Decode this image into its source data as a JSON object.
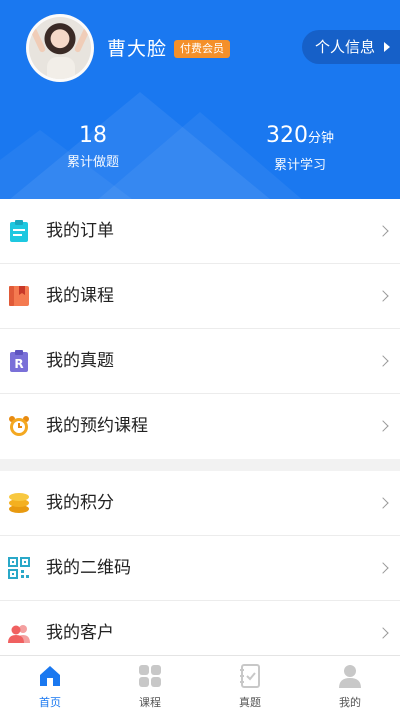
{
  "profile": {
    "name": "曹大脸",
    "badge": "付费会员",
    "info_button": "个人信息"
  },
  "stats": {
    "questions_count": "18",
    "questions_label": "累计做题",
    "study_value": "320",
    "study_unit": "分钟",
    "study_label": "累计学习"
  },
  "menu_group_1": [
    {
      "label": "我的订单",
      "icon": "clipboard-icon",
      "color": "#1ec8e0"
    },
    {
      "label": "我的课程",
      "icon": "book-icon",
      "color": "#f06848"
    },
    {
      "label": "我的真题",
      "icon": "exam-r-icon",
      "color": "#7a70d8"
    },
    {
      "label": "我的预约课程",
      "icon": "alarm-clock-icon",
      "color": "#f4a020"
    }
  ],
  "menu_group_2": [
    {
      "label": "我的积分",
      "icon": "coins-icon",
      "color": "#f4b020"
    },
    {
      "label": "我的二维码",
      "icon": "qrcode-icon",
      "color": "#2aa8c8"
    },
    {
      "label": "我的客户",
      "icon": "customers-icon",
      "color": "#f06060"
    }
  ],
  "tabbar": [
    {
      "label": "首页",
      "icon": "home-icon",
      "active": true
    },
    {
      "label": "课程",
      "icon": "grid-icon",
      "active": false
    },
    {
      "label": "真题",
      "icon": "notebook-icon",
      "active": false
    },
    {
      "label": "我的",
      "icon": "person-icon",
      "active": false
    }
  ],
  "colors": {
    "primary": "#1a78f0",
    "badge": "#f4902a",
    "tab_active": "#1a78f0",
    "tab_inactive": "#c8c8c8"
  }
}
